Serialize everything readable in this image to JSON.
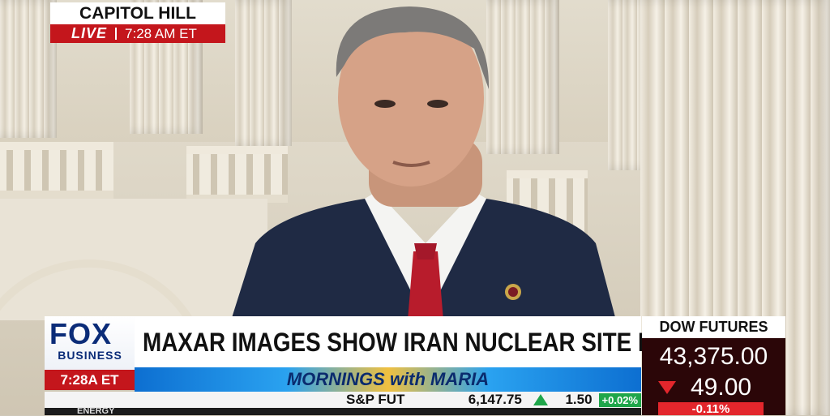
{
  "location": {
    "name": "CAPITOL HILL",
    "live": "LIVE",
    "time": "7:28 AM ET"
  },
  "network": {
    "logo_top": "FOX",
    "logo_bottom": "BUSINESS",
    "time": "7:28A ET"
  },
  "headline": "MAXAR IMAGES SHOW IRAN NUCLEAR SITE DAMAGE",
  "show": {
    "title": "MORNINGS with MARIA"
  },
  "dow": {
    "title": "DOW FUTURES",
    "value": "43,375.00",
    "change": "49.00",
    "direction": "down",
    "percent": "-0.11%"
  },
  "ticker": {
    "name": "S&P FUT",
    "value": "6,147.75",
    "change": "1.50",
    "percent": "+0.02%",
    "direction": "up",
    "sector": "ENERGY"
  },
  "colors": {
    "fox_red": "#c4161c",
    "fox_blue": "#0b2c78",
    "up_green": "#1fa64a",
    "down_red": "#e3262c"
  }
}
